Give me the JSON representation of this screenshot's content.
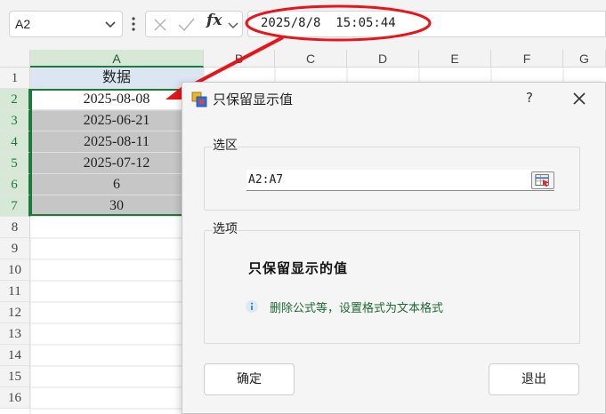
{
  "formula_bar": {
    "name_box": "A2",
    "fx_label": "fx",
    "formula": "2025/8/8  15:05:44"
  },
  "grid": {
    "columns": [
      "A",
      "B",
      "C",
      "D",
      "E",
      "F",
      "G"
    ],
    "rows": [
      "1",
      "2",
      "3",
      "4",
      "5",
      "6",
      "7",
      "8",
      "9",
      "10",
      "11",
      "12",
      "13",
      "14",
      "15",
      "16"
    ],
    "column_a": [
      "数据",
      "2025-08-08",
      "2025-06-21",
      "2025-08-11",
      "2025-07-12",
      "6",
      "30"
    ]
  },
  "dialog": {
    "title": "只保留显示值",
    "help": "?",
    "range_section": {
      "label": "选区",
      "value": "A2:A7"
    },
    "options_section": {
      "label": "选项",
      "heading": "只保留显示的值",
      "info": "删除公式等，设置格式为文本格式"
    },
    "ok_label": "确定",
    "exit_label": "退出"
  },
  "colors": {
    "accent_green": "#1e7a3a",
    "callout_red": "#e8141a",
    "header_fill": "#dce6f3",
    "selection_fill": "#c6c6c6"
  }
}
